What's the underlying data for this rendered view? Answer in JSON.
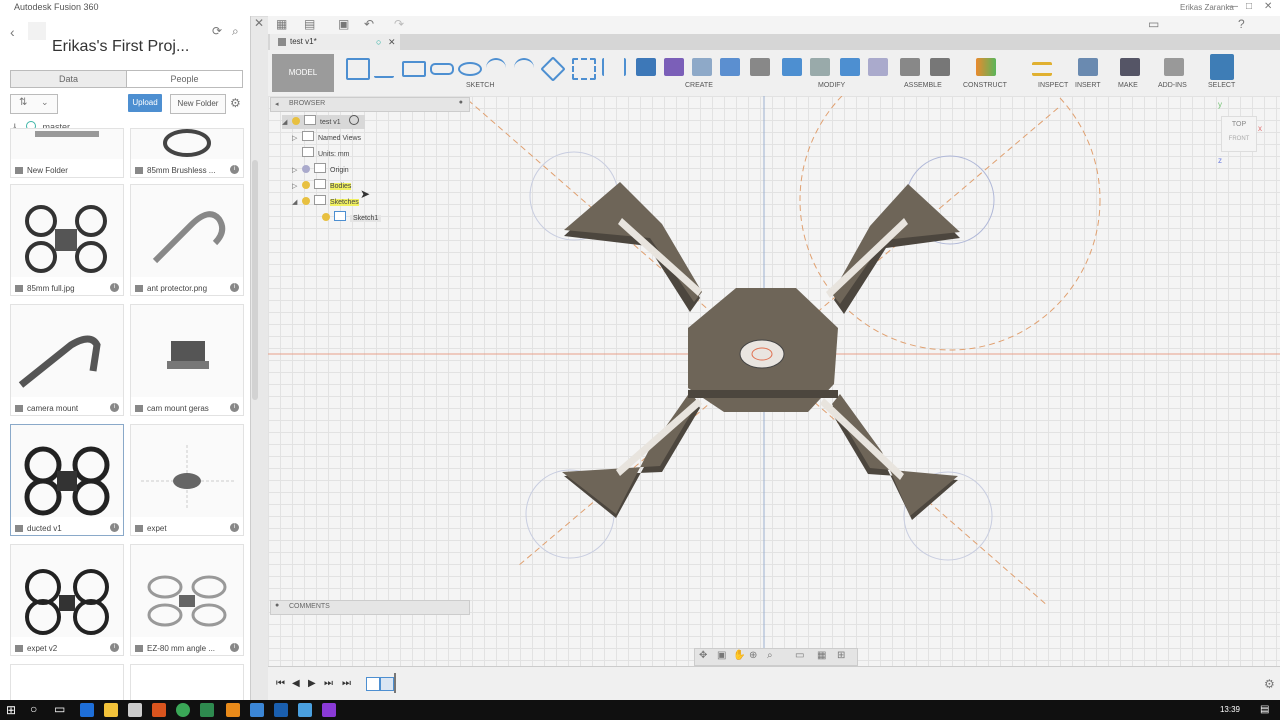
{
  "window": {
    "title": "Autodesk Fusion 360",
    "user": "Erikas Zaranka"
  },
  "data_panel": {
    "project_title": "Erikas's First Proj...",
    "tabs": [
      {
        "label": "Data",
        "active": true
      },
      {
        "label": "People",
        "active": false
      }
    ],
    "upload_label": "Upload",
    "new_folder_label": "New Folder",
    "branch": "master",
    "items": [
      {
        "label": "New Folder",
        "kind": "folder"
      },
      {
        "label": "85mm Brushless ...",
        "kind": "model"
      },
      {
        "label": "85mm full.jpg",
        "kind": "image"
      },
      {
        "label": "ant protector.png",
        "kind": "image"
      },
      {
        "label": "camera mount",
        "kind": "model"
      },
      {
        "label": "cam mount geras",
        "kind": "model"
      },
      {
        "label": "ducted v1",
        "kind": "model",
        "selected": true
      },
      {
        "label": "expet",
        "kind": "model"
      },
      {
        "label": "expet v2",
        "kind": "model"
      },
      {
        "label": "EZ-80 mm angle ...",
        "kind": "model"
      }
    ]
  },
  "document": {
    "tab_label": "test v1*"
  },
  "toolbar": {
    "workspace": "MODEL",
    "groups": [
      {
        "label": "SKETCH"
      },
      {
        "label": "CREATE"
      },
      {
        "label": "MODIFY"
      },
      {
        "label": "ASSEMBLE"
      },
      {
        "label": "CONSTRUCT"
      },
      {
        "label": "INSPECT"
      },
      {
        "label": "INSERT"
      },
      {
        "label": "MAKE"
      },
      {
        "label": "ADD-INS"
      },
      {
        "label": "SELECT"
      }
    ]
  },
  "browser": {
    "header": "BROWSER",
    "nodes": [
      {
        "label": "test v1"
      },
      {
        "label": "Named Views"
      },
      {
        "label": "Units: mm"
      },
      {
        "label": "Origin"
      },
      {
        "label": "Bodies"
      },
      {
        "label": "Sketches"
      },
      {
        "label": "Sketch1"
      }
    ]
  },
  "comments": {
    "header": "COMMENTS"
  },
  "viewcube": {
    "top_label": "TOP",
    "front_label": "FRONT"
  },
  "taskbar": {
    "time": "13:39"
  },
  "colors": {
    "accent": "#4d8fd1",
    "model_button": "#9b9b9b",
    "body": "#6e6558"
  }
}
